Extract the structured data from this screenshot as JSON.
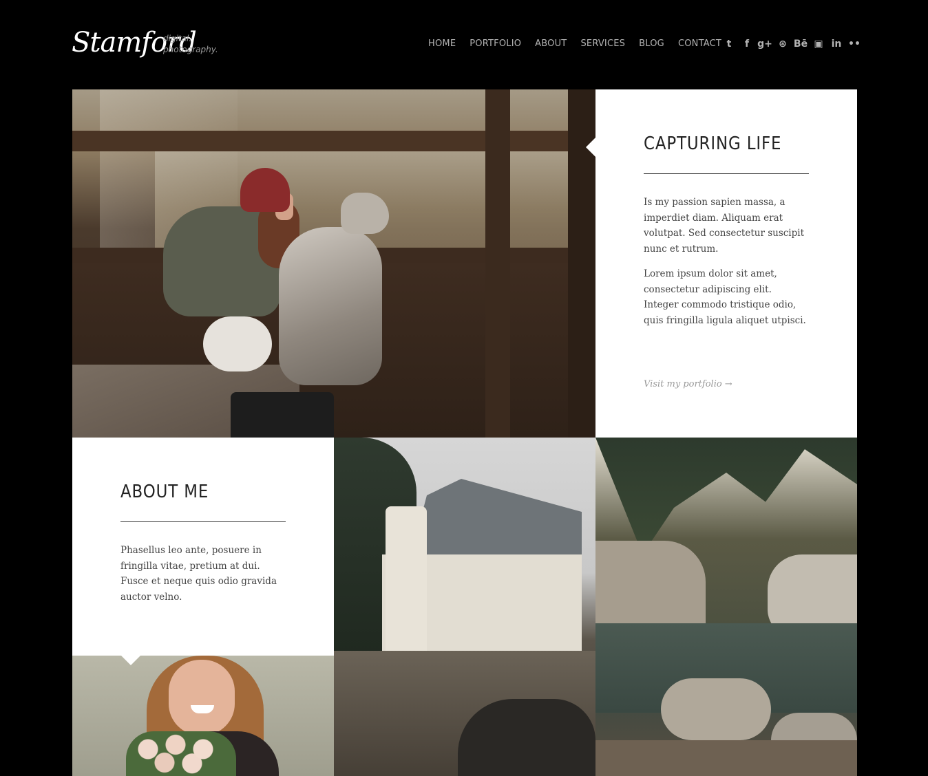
{
  "header": {
    "logo": "Stamford",
    "tagline_line1": "digital.",
    "tagline_line2": "photography."
  },
  "nav": {
    "items": [
      "HOME",
      "PORTFOLIO",
      "ABOUT",
      "SERVICES",
      "BLOG",
      "CONTACT"
    ]
  },
  "social": {
    "icons": [
      {
        "name": "twitter-icon",
        "glyph": "t"
      },
      {
        "name": "facebook-icon",
        "glyph": "f"
      },
      {
        "name": "google-plus-icon",
        "glyph": "g+"
      },
      {
        "name": "dribbble-icon",
        "glyph": "⊛"
      },
      {
        "name": "behance-icon",
        "glyph": "Bē"
      },
      {
        "name": "youtube-icon",
        "glyph": "▣"
      },
      {
        "name": "linkedin-icon",
        "glyph": "in"
      },
      {
        "name": "flickr-icon",
        "glyph": "••"
      }
    ]
  },
  "capturing": {
    "title": "CAPTURING LIFE",
    "paragraph1": "Is my passion sapien massa, a imperdiet diam. Aliquam erat volutpat. Sed consectetur suscipit nunc et rutrum.",
    "paragraph2": "Lorem ipsum dolor sit amet, consectetur adipiscing elit. Integer commodo tristique odio, quis fringilla ligula aliquet utpisci.",
    "link": "Visit my portfolio →"
  },
  "about": {
    "title": "ABOUT ME",
    "paragraph": "Phasellus leo ante, posuere in fringilla vitae, pretium at dui. Fusce et neque quis odio gravida auctor velno."
  }
}
